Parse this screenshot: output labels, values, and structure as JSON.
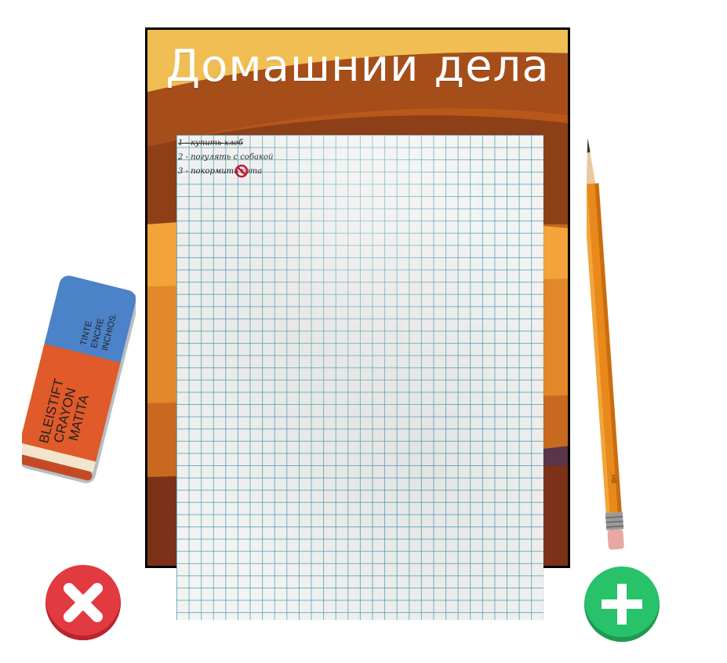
{
  "board": {
    "title": "Домашнии дела"
  },
  "tasks": [
    {
      "text": "1 - купить хлеб",
      "done": true
    },
    {
      "text": "2 - погулять с собакой",
      "done": false
    },
    {
      "text": "3 - покормить кота",
      "done": false
    }
  ],
  "eraser": {
    "blue_text": [
      "TINTE",
      "ENCRE",
      "INCHIOS."
    ],
    "red_text": [
      "BLEISTIFT",
      "CRAYON",
      "MATITA"
    ]
  },
  "pencil": {
    "label": "HB"
  },
  "icons": {
    "delete": "close-icon",
    "add": "plus-icon",
    "task3_marker": "forbid-icon"
  },
  "colors": {
    "delete_button": "#e23a41",
    "add_button": "#27c26a",
    "grid_lines": "#40a0b4"
  }
}
